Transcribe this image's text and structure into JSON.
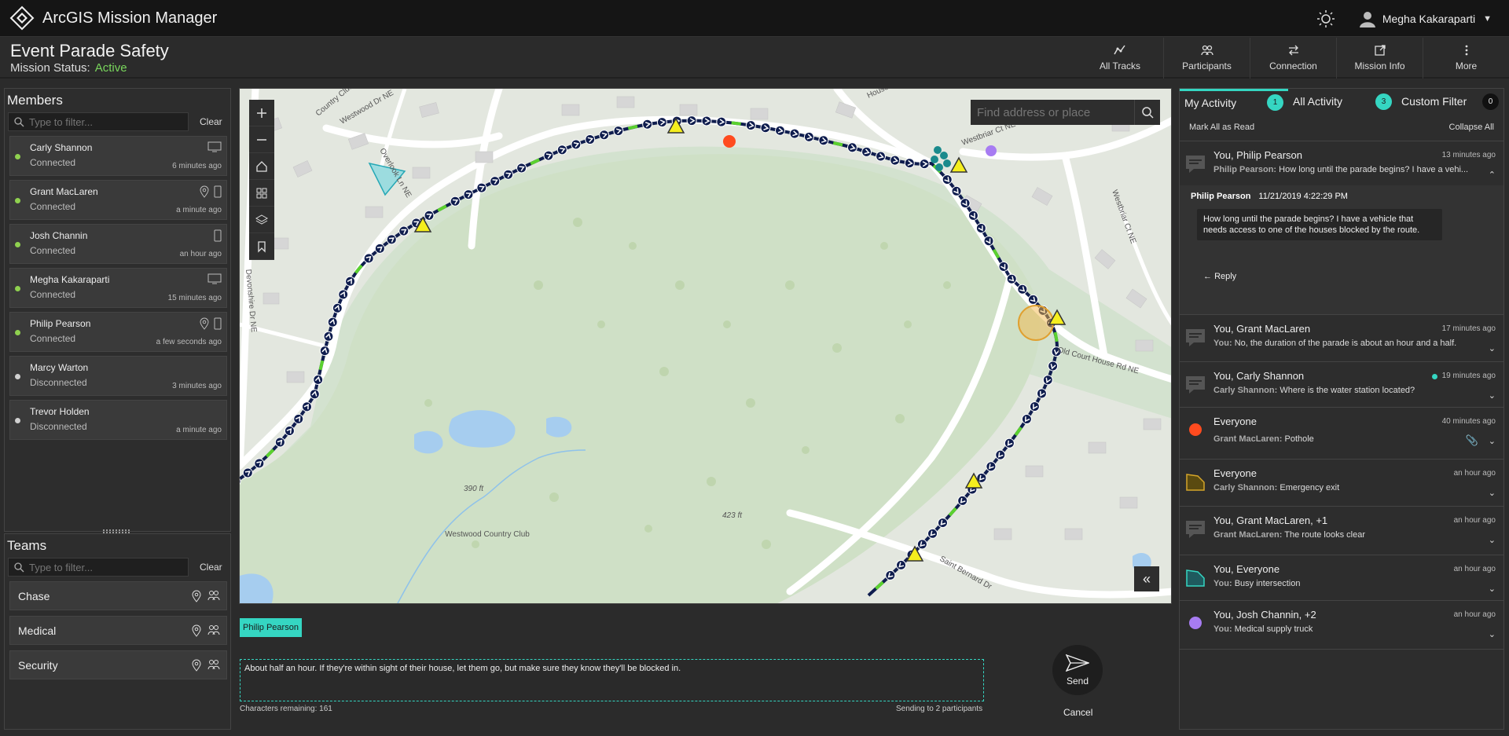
{
  "app": {
    "title": "ArcGIS Mission Manager",
    "user": "Megha Kakaraparti"
  },
  "mission": {
    "title": "Event Parade Safety",
    "status_label": "Mission Status:",
    "status_value": "Active"
  },
  "nav": [
    {
      "label": "All Tracks",
      "icon": "tracks-icon"
    },
    {
      "label": "Participants",
      "icon": "participants-icon"
    },
    {
      "label": "Connection",
      "icon": "connection-icon"
    },
    {
      "label": "Mission Info",
      "icon": "mission-info-icon"
    },
    {
      "label": "More",
      "icon": "more-icon"
    }
  ],
  "members": {
    "title": "Members",
    "filter_placeholder": "Type to filter...",
    "clear": "Clear",
    "items": [
      {
        "name": "Carly Shannon",
        "status": "Connected",
        "time": "6 minutes ago"
      },
      {
        "name": "Grant MacLaren",
        "status": "Connected",
        "time": "a minute ago"
      },
      {
        "name": "Josh Channin",
        "status": "Connected",
        "time": "an hour ago"
      },
      {
        "name": "Megha Kakaraparti",
        "status": "Connected",
        "time": "15 minutes ago"
      },
      {
        "name": "Philip Pearson",
        "status": "Connected",
        "time": "a few seconds ago"
      },
      {
        "name": "Marcy Warton",
        "status": "Disconnected",
        "time": "3 minutes ago"
      },
      {
        "name": "Trevor Holden",
        "status": "Disconnected",
        "time": "a minute ago"
      }
    ]
  },
  "teams": {
    "title": "Teams",
    "filter_placeholder": "Type to filter...",
    "clear": "Clear",
    "items": [
      {
        "name": "Chase"
      },
      {
        "name": "Medical"
      },
      {
        "name": "Security"
      }
    ]
  },
  "map": {
    "search_placeholder": "Find address or place",
    "labels": [
      "Westwood Dr NE",
      "Country Club D",
      "Overlook Ln NE",
      "Devonshire Dr NE",
      "Westbriar Ct NE",
      "Westbriar Ct NE",
      "Old Court House Rd NE",
      "House Rd NE",
      "Saint Bernard Dr",
      "Westwood Country Club",
      "390 ft",
      "423 ft"
    ]
  },
  "composer": {
    "recipient": "Philip Pearson",
    "message": "About half an hour. If they're within sight of their house, let them go, but make sure they know they'll be blocked in.",
    "chars_remaining": "Characters remaining: 161",
    "sending": "Sending to 2 participants",
    "send": "Send",
    "cancel": "Cancel"
  },
  "activity": {
    "tabs": [
      {
        "label": "My Activity",
        "count": "1"
      },
      {
        "label": "All Activity",
        "count": "3"
      },
      {
        "label": "Custom Filter",
        "count": "0"
      }
    ],
    "mark_all": "Mark All as Read",
    "collapse_all": "Collapse All",
    "expanded": {
      "title": "You, Philip Pearson",
      "time": "13 minutes ago",
      "preview_name": "Philip Pearson:",
      "preview_text": "How long until the parade begins? I have a vehi...",
      "sender": "Philip Pearson",
      "timestamp": "11/21/2019 4:22:29 PM",
      "message": "How long until the parade begins? I have a vehicle that needs access to one of the houses blocked by the route.",
      "reply": "Reply"
    },
    "items": [
      {
        "title": "You, Grant MacLaren",
        "time": "17 minutes ago",
        "from": "You:",
        "text": "No, the duration of the parade is about an hour and a half.",
        "icon": "chat-icon"
      },
      {
        "title": "You, Carly Shannon",
        "time": "19 minutes ago",
        "from": "Carly Shannon:",
        "text": "Where is the water station located?",
        "icon": "chat-icon"
      },
      {
        "title": "Everyone",
        "time": "40 minutes ago",
        "from": "Grant MacLaren:",
        "text": "Pothole",
        "icon": "point-marker-icon"
      },
      {
        "title": "Everyone",
        "time": "an hour ago",
        "from": "Carly Shannon:",
        "text": "Emergency exit",
        "icon": "polygon-marker-icon"
      },
      {
        "title": "You, Grant MacLaren, +1",
        "time": "an hour ago",
        "from": "Grant MacLaren:",
        "text": "The route looks clear",
        "icon": "chat-icon"
      },
      {
        "title": "You, Everyone",
        "time": "an hour ago",
        "from": "You:",
        "text": "Busy intersection",
        "icon": "polygon-marker-icon"
      },
      {
        "title": "You, Josh Channin, +2",
        "time": "an hour ago",
        "from": "You:",
        "text": "Medical supply truck",
        "icon": "point-marker-icon"
      }
    ]
  },
  "colors": {
    "accent": "#35d6c2",
    "active": "#79d65c",
    "connected": "#8fd14f",
    "disconnected": "#d0d0d0",
    "route": "#0f1d4e",
    "route_ok": "#5bd12f",
    "marker_yellow": "#f5ee1e",
    "pothole": "#ff4b1f",
    "purple": "#a77cf2"
  }
}
